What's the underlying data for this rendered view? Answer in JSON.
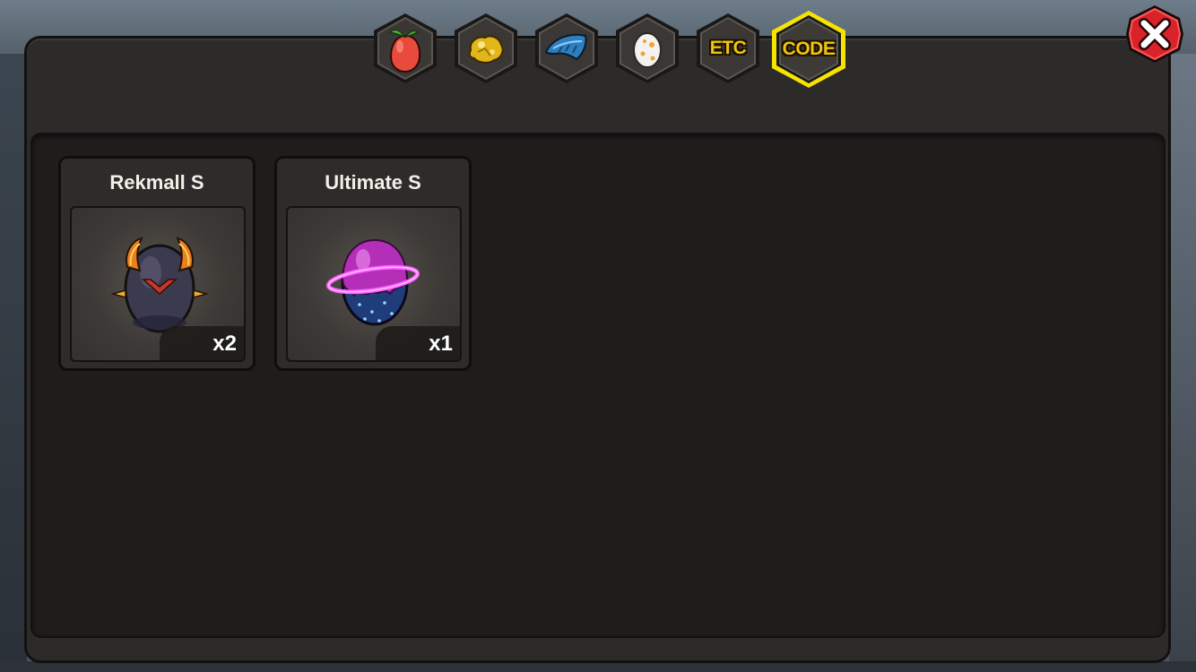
{
  "tabs": [
    {
      "name": "fruit",
      "icon": "fruit-icon",
      "label": ""
    },
    {
      "name": "gold",
      "icon": "gold-nugget-icon",
      "label": ""
    },
    {
      "name": "feather",
      "icon": "feather-icon",
      "label": ""
    },
    {
      "name": "egg",
      "icon": "egg-icon",
      "label": ""
    },
    {
      "name": "etc",
      "icon": "",
      "label": "ETC"
    },
    {
      "name": "code",
      "icon": "",
      "label": "CODE",
      "selected": true
    }
  ],
  "items": [
    {
      "name": "Rekmall S",
      "count": "x2",
      "icon": "armored-egg-icon"
    },
    {
      "name": "Ultimate S",
      "count": "x1",
      "icon": "ringed-egg-icon"
    }
  ],
  "colors": {
    "tab_selected_border": "#f5e400",
    "tab_label": "#f1c40f",
    "close_button": "#d9232b"
  }
}
